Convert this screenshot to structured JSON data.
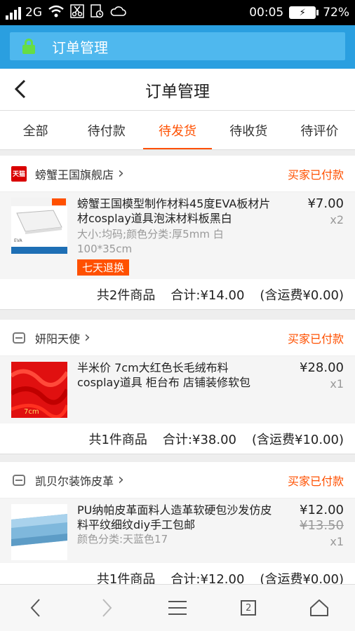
{
  "status_bar": {
    "network": "2G",
    "time": "00:05",
    "battery_percent": "72%"
  },
  "browser": {
    "url_title": "订单管理"
  },
  "header": {
    "title": "订单管理"
  },
  "tabs": [
    {
      "label": "全部",
      "active": false
    },
    {
      "label": "待付款",
      "active": false
    },
    {
      "label": "待发货",
      "active": true
    },
    {
      "label": "待收货",
      "active": false
    },
    {
      "label": "待评价",
      "active": false
    }
  ],
  "orders": [
    {
      "shop_name": "螃蟹王国旗舰店",
      "shop_icon_text": "天猫",
      "status": "买家已付款",
      "item": {
        "title": "螃蟹王国模型制作材料45度EVA板材片材cosplay道具泡沫材料板黑白",
        "sku": "大小:均码;颜色分类:厚5mm 白100*35cm",
        "badge": "七天退换",
        "price": "¥7.00",
        "quantity": "x2"
      },
      "summary": {
        "count": "共2件商品",
        "total": "合计:¥14.00",
        "shipping": "(含运费¥0.00)"
      }
    },
    {
      "shop_name": "妍阳天使",
      "status": "买家已付款",
      "item": {
        "title": "半米价 7cm大红色长毛绒布料 cosplay道具 柜台布 店铺装修软包",
        "price": "¥28.00",
        "quantity": "x1"
      },
      "summary": {
        "count": "共1件商品",
        "total": "合计:¥38.00",
        "shipping": "(含运费¥10.00)"
      }
    },
    {
      "shop_name": "凯贝尔装饰皮革",
      "status": "买家已付款",
      "item": {
        "title": "PU纳帕皮革面料人造革软硬包沙发仿皮料平纹细纹diy手工包邮",
        "sku": "颜色分类:天蓝色17",
        "price": "¥12.00",
        "original_price": "¥13.50",
        "quantity": "x1"
      },
      "summary": {
        "count": "共1件商品",
        "total": "合计:¥12.00",
        "shipping": "(含运费¥0.00)"
      }
    }
  ],
  "bottom_nav": {
    "tab_count": "2"
  }
}
